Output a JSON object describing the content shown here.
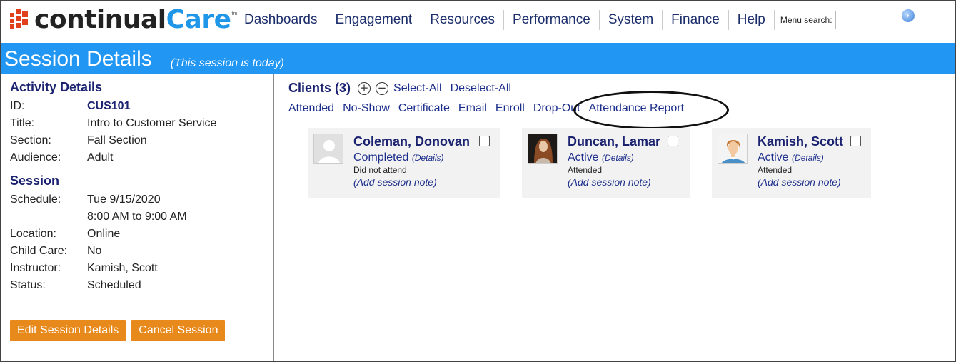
{
  "brand": {
    "word_a": "continual",
    "word_b": "Care",
    "tm": "tm"
  },
  "nav": {
    "items": [
      "Dashboards",
      "Engagement",
      "Resources",
      "Performance",
      "System",
      "Finance",
      "Help"
    ]
  },
  "menu_search": {
    "label": "Menu search:",
    "value": "",
    "placeholder": ""
  },
  "page": {
    "title": "Session Details",
    "subtitle": "(This session is today)"
  },
  "activity": {
    "heading": "Activity Details",
    "fields": [
      {
        "k": "ID:",
        "v": "CUS101"
      },
      {
        "k": "Title:",
        "v": "Intro to Customer Service"
      },
      {
        "k": "Section:",
        "v": "Fall Section"
      },
      {
        "k": "Audience:",
        "v": "Adult"
      }
    ]
  },
  "session": {
    "heading": "Session",
    "fields": [
      {
        "k": "Schedule:",
        "v": "Tue 9/15/2020"
      },
      {
        "k": "",
        "v": "8:00 AM to 9:00 AM"
      },
      {
        "k": "Location:",
        "v": "Online"
      },
      {
        "k": "Child Care:",
        "v": "No"
      },
      {
        "k": "Instructor:",
        "v": "Kamish, Scott"
      },
      {
        "k": "Status:",
        "v": "Scheduled"
      }
    ]
  },
  "buttons": {
    "edit": "Edit Session Details",
    "cancel": "Cancel Session"
  },
  "clients": {
    "title": "Clients (3)",
    "select_all": "Select-All",
    "deselect_all": "Deselect-All",
    "actions": [
      "Attended",
      "No-Show",
      "Certificate",
      "Email",
      "Enroll",
      "Drop-Out",
      "Attendance Report"
    ],
    "cards": [
      {
        "name": "Coleman, Donovan",
        "status": "Completed",
        "details": "(Details)",
        "attendance": "Did not attend",
        "note": "(Add session note)"
      },
      {
        "name": "Duncan, Lamar",
        "status": "Active",
        "details": "(Details)",
        "attendance": "Attended",
        "note": "(Add session note)"
      },
      {
        "name": "Kamish, Scott",
        "status": "Active",
        "details": "(Details)",
        "attendance": "Attended",
        "note": "(Add session note)"
      }
    ]
  },
  "colors": {
    "accent": "#2196f3",
    "brand_red": "#e0401c",
    "button": "#e8891b",
    "link": "#1b2d8b"
  }
}
